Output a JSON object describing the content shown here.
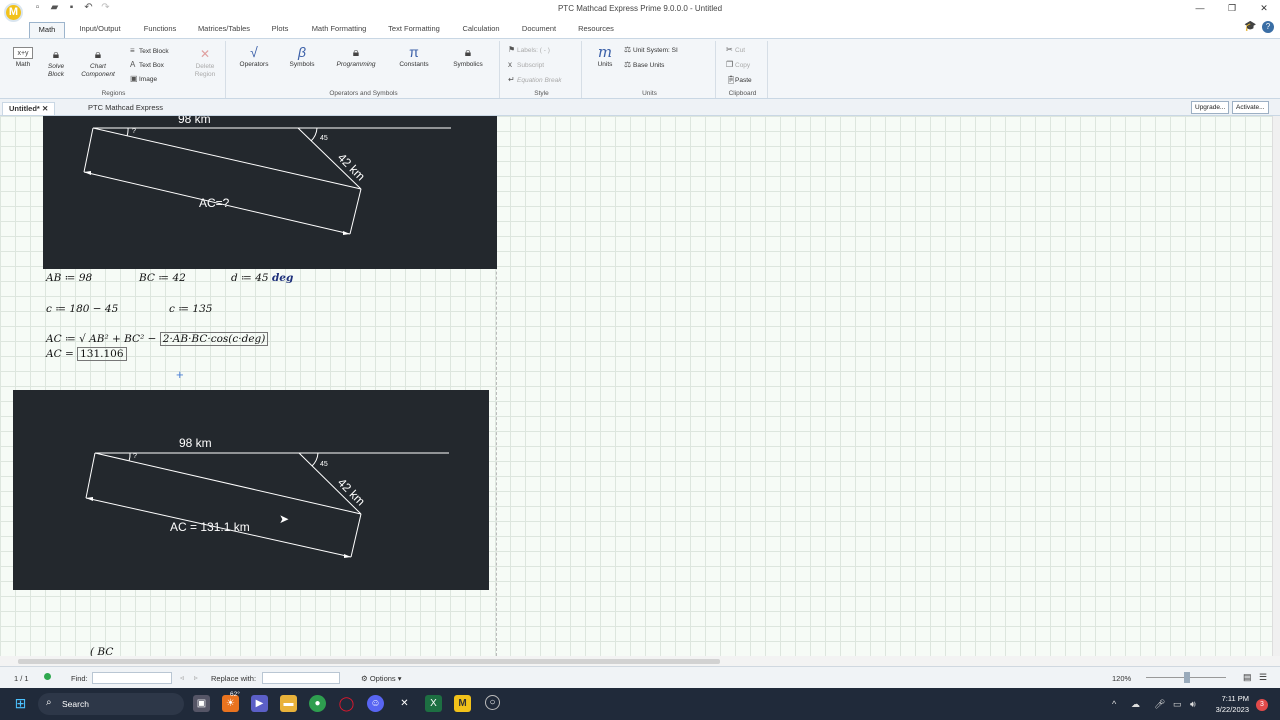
{
  "window": {
    "title": "PTC Mathcad Express Prime 9.0.0.0 - Untitled",
    "logo_letter": "M",
    "controls": [
      "—",
      "❐",
      "✕"
    ]
  },
  "tabs": [
    "Math",
    "Input/Output",
    "Functions",
    "Matrices/Tables",
    "Plots",
    "Math Formatting",
    "Text Formatting",
    "Calculation",
    "Document",
    "Resources"
  ],
  "ribbon": {
    "regions": {
      "math": "Math",
      "solve_block": "Solve Block",
      "chart_component": "Chart Component",
      "text_block": "Text Block",
      "text_box": "Text Box",
      "image": "Image",
      "delete_region": "Delete Region",
      "label": "Regions"
    },
    "operators": {
      "operators": "Operators",
      "symbols": "Symbols",
      "programming": "Programming",
      "constants": "Constants",
      "symbolics": "Symbolics",
      "label": "Operators and Symbols"
    },
    "style": {
      "labels": "Labels: ( - )",
      "subscript": "Subscript",
      "equation_break": "Equation Break",
      "label": "Style"
    },
    "units": {
      "units": "Units",
      "unit_system": "Unit System: SI",
      "base_units": "Base Units",
      "label": "Units"
    },
    "clipboard": {
      "cut": "Cut",
      "copy": "Copy",
      "paste": "Paste",
      "label": "Clipboard"
    }
  },
  "doc_tabs": {
    "active": "Untitled*",
    "second": "PTC Mathcad Express",
    "upgrade": "Upgrade...",
    "activate": "Activate..."
  },
  "diagram1": {
    "top_label": "98 km",
    "side_label": "42 km",
    "result_label": "AC=?",
    "angle_label": "45",
    "q_label": "?"
  },
  "diagram2": {
    "top_label": "98 km",
    "side_label": "42 km",
    "result_label": "AC = 131.1 km",
    "angle_label": "45",
    "q_label": "?"
  },
  "math": {
    "ab": "AB ≔ 98",
    "bc": "BC ≔ 42",
    "d_def": "d ≔ 45",
    "d_unit": "deg",
    "c1": "c ≔ 180 − 45",
    "c2": "c ≔ 135",
    "ac_def": "AC ≔ √ AB² + BC² − ",
    "ac_box": "2·AB·BC·cos(c·deg)",
    "ac_res_prefix": "AC =",
    "ac_res_value": "131.106",
    "partial": "( BC"
  },
  "status": {
    "page": "1 / 1",
    "find": "Find:",
    "replace": "Replace with:",
    "options": "Options",
    "zoom": "120%"
  },
  "taskbar": {
    "search": "Search",
    "weather": "62°",
    "time": "7:11 PM",
    "date": "3/22/2023",
    "notif": "3"
  }
}
